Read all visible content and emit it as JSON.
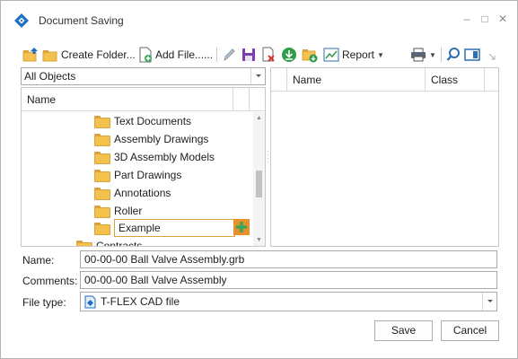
{
  "window": {
    "title": "Document Saving",
    "minimize_glyph": "–",
    "maximize_glyph": "□",
    "close_glyph": "✕"
  },
  "toolbar": {
    "create_folder_label": "Create Folder...",
    "add_file_label": "Add File......",
    "report_label": "Report",
    "icons": [
      "folder-up-icon",
      "create-folder-icon",
      "add-file-icon",
      "pencil-icon",
      "save-icon",
      "delete-icon",
      "download-icon",
      "folder-download-icon",
      "report-icon",
      "print-icon",
      "search-icon",
      "view-panel-icon"
    ]
  },
  "tree": {
    "filter_value": "All Objects",
    "column_name": "Name",
    "items": [
      {
        "label": "Text Documents"
      },
      {
        "label": "Assembly Drawings"
      },
      {
        "label": "3D Assembly Models"
      },
      {
        "label": "Part Drawings"
      },
      {
        "label": "Annotations"
      },
      {
        "label": "Roller"
      }
    ],
    "editing_item": "Example",
    "partial_item": "Contracts"
  },
  "list": {
    "columns": [
      "Name",
      "Class"
    ]
  },
  "form": {
    "name_label": "Name:",
    "name_value": "00-00-00 Ball Valve Assembly.grb",
    "comments_label": "Comments:",
    "comments_value": "00-00-00 Ball Valve Assembly",
    "filetype_label": "File type:",
    "filetype_value": "T-FLEX CAD file"
  },
  "buttons": {
    "save": "Save",
    "cancel": "Cancel"
  },
  "colors": {
    "accent": "#1f6fc5",
    "folder": "#f2c14e",
    "add_button": "#e8902b",
    "add_plus": "#3aa856",
    "delete": "#d9342b",
    "download": "#2e9c4a"
  }
}
